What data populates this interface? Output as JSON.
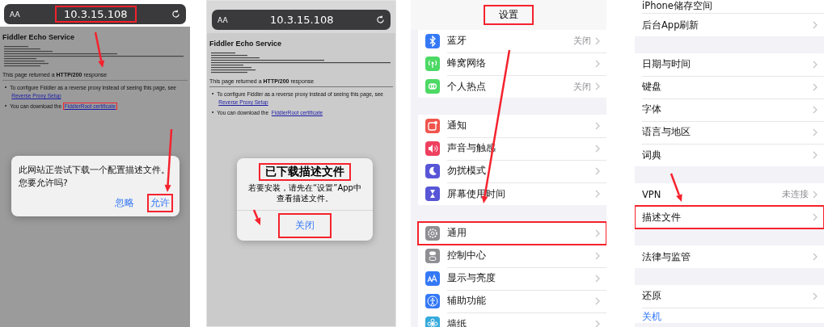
{
  "panels": [
    {
      "kind": "browser",
      "dimmed": true,
      "text_size_label": "AA",
      "address": "10.3.15.108",
      "address_highlighted": true,
      "page_title": "Fiddler Echo Service",
      "response_line": "This page returned a **HTTP/200** response",
      "bullets": [
        {
          "marker": "•",
          "text": "To configure Fiddler as a reverse proxy instead of seeing this page, see",
          "link": "Reverse Proxy Setup",
          "link_highlighted": false
        },
        {
          "marker": "•",
          "text": "You can download the",
          "link": "FiddlerRoot certificate",
          "link_highlighted": true
        }
      ],
      "dialog": {
        "message": "此网站正尝试下载一个配置描述文件。您要允许吗?",
        "buttons": [
          {
            "label": "忽略",
            "highlighted": false
          },
          {
            "label": "允许",
            "highlighted": true
          }
        ]
      }
    },
    {
      "kind": "browser",
      "dimmed": false,
      "text_size_label": "AA",
      "address": "10.3.15.108",
      "address_highlighted": false,
      "page_title": "Fiddler Echo Service",
      "response_line": "This page returned a **HTTP/200** response",
      "bullets": [
        {
          "marker": "•",
          "text": "To configure Fiddler as a reverse proxy instead of seeing this page, see",
          "link": "Reverse Proxy Setup",
          "link_highlighted": false
        },
        {
          "marker": "•",
          "text": "You can download the",
          "link": "FiddlerRoot certificate",
          "link_highlighted": false
        }
      ],
      "dialog": {
        "title": "已下载描述文件",
        "title_highlighted": true,
        "message": "若要安装，请先在“设置”App中查看描述文件。",
        "buttons": [
          {
            "label": "关闭",
            "highlighted": true
          }
        ]
      }
    },
    {
      "kind": "settings",
      "title": "设置",
      "title_highlighted": true,
      "groups": [
        [
          {
            "label": "蓝牙",
            "value": "关闭",
            "color": "#3478f6",
            "highlighted": false
          },
          {
            "label": "蜂窝网络",
            "color": "#4cd964",
            "highlighted": false
          },
          {
            "label": "个人热点",
            "value": "关闭",
            "color": "#4cd964",
            "highlighted": false
          }
        ],
        [
          {
            "label": "通知",
            "color": "#f0544c",
            "highlighted": false
          },
          {
            "label": "声音与触感",
            "color": "#ee3f5f",
            "highlighted": false
          },
          {
            "label": "勿扰模式",
            "color": "#5856d6",
            "highlighted": false
          },
          {
            "label": "屏幕使用时间",
            "color": "#5856d6",
            "highlighted": false
          }
        ],
        [
          {
            "label": "通用",
            "color": "#8e8e93",
            "highlighted": true
          },
          {
            "label": "控制中心",
            "color": "#8e8e93",
            "highlighted": false
          },
          {
            "label": "显示与亮度",
            "color": "#3478f6",
            "highlighted": false
          },
          {
            "label": "辅助功能",
            "color": "#3478f6",
            "highlighted": false
          },
          {
            "label": "墙纸",
            "color": "#35aadc",
            "highlighted": false
          }
        ]
      ]
    },
    {
      "kind": "settings",
      "groups": [
        [
          {
            "label": "iPhone储存空间",
            "highlighted": false
          },
          {
            "label": "后台App刷新",
            "highlighted": false
          }
        ],
        [
          {
            "label": "日期与时间",
            "highlighted": false
          },
          {
            "label": "键盘",
            "highlighted": false
          },
          {
            "label": "字体",
            "highlighted": false
          },
          {
            "label": "语言与地区",
            "highlighted": false
          },
          {
            "label": "词典",
            "highlighted": false
          }
        ],
        [
          {
            "label": "VPN",
            "value": "未连接",
            "highlighted": false
          },
          {
            "label": "描述文件",
            "highlighted": true
          }
        ],
        [
          {
            "label": "法律与监管",
            "highlighted": false
          }
        ],
        [
          {
            "kind": "nav",
            "label": "还原",
            "highlighted": false
          },
          {
            "kind": "link",
            "label": "关机",
            "highlighted": false
          }
        ]
      ]
    }
  ]
}
